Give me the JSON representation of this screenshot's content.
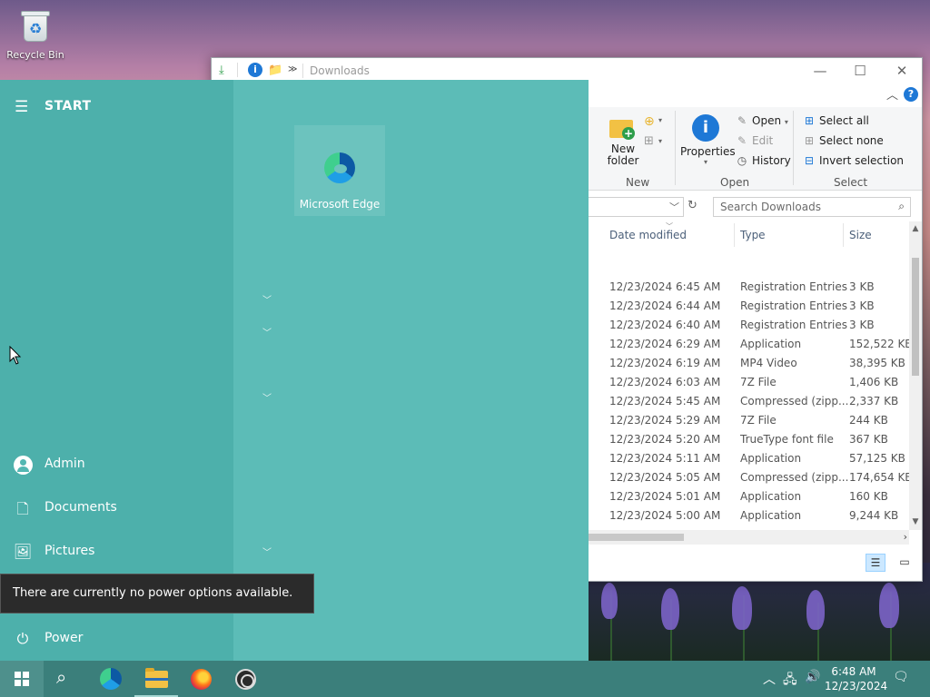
{
  "desktop": {
    "recycle_bin_label": "Recycle Bin"
  },
  "explorer": {
    "title": "Downloads",
    "window_buttons": {
      "minimize": "—",
      "maximize": "☐",
      "close": "✕"
    },
    "ribbon": {
      "new_folder_label": "New folder",
      "properties_label": "Properties",
      "open_label": "Open",
      "edit_label": "Edit",
      "history_label": "History",
      "select_all_label": "Select all",
      "select_none_label": "Select none",
      "invert_selection_label": "Invert selection",
      "groups": {
        "new": "New",
        "open": "Open",
        "select": "Select"
      }
    },
    "search_placeholder": "Search Downloads",
    "columns": {
      "date_modified": "Date modified",
      "type": "Type",
      "size": "Size"
    },
    "files": [
      {
        "date": "12/23/2024 6:45 AM",
        "type": "Registration Entries",
        "size": "3 KB"
      },
      {
        "date": "12/23/2024 6:44 AM",
        "type": "Registration Entries",
        "size": "3 KB"
      },
      {
        "date": "12/23/2024 6:40 AM",
        "type": "Registration Entries",
        "size": "3 KB"
      },
      {
        "date": "12/23/2024 6:29 AM",
        "type": "Application",
        "size": "152,522 KB"
      },
      {
        "date": "12/23/2024 6:19 AM",
        "type": "MP4 Video",
        "size": "38,395 KB"
      },
      {
        "date": "12/23/2024 6:03 AM",
        "type": "7Z File",
        "size": "1,406 KB"
      },
      {
        "date": "12/23/2024 5:45 AM",
        "type": "Compressed (zipp...",
        "size": "2,337 KB"
      },
      {
        "date": "12/23/2024 5:29 AM",
        "type": "7Z File",
        "size": "244 KB"
      },
      {
        "date": "12/23/2024 5:20 AM",
        "type": "TrueType font file",
        "size": "367 KB"
      },
      {
        "date": "12/23/2024 5:11 AM",
        "type": "Application",
        "size": "57,125 KB"
      },
      {
        "date": "12/23/2024 5:05 AM",
        "type": "Compressed (zipp...",
        "size": "174,654 KB"
      },
      {
        "date": "12/23/2024 5:01 AM",
        "type": "Application",
        "size": "160 KB"
      },
      {
        "date": "12/23/2024 5:00 AM",
        "type": "Application",
        "size": "9,244 KB"
      }
    ]
  },
  "start_menu": {
    "title": "START",
    "tile_edge_label": "Microsoft Edge",
    "side_items": {
      "user": "Admin",
      "documents": "Documents",
      "pictures": "Pictures",
      "power": "Power"
    },
    "tooltip": "There are currently no power options available."
  },
  "taskbar": {
    "time": "6:48 AM",
    "date": "12/23/2024"
  },
  "colors": {
    "start_accent": "#53b7b2",
    "taskbar": "#3b7f7b",
    "link_blue": "#1e78d6"
  }
}
